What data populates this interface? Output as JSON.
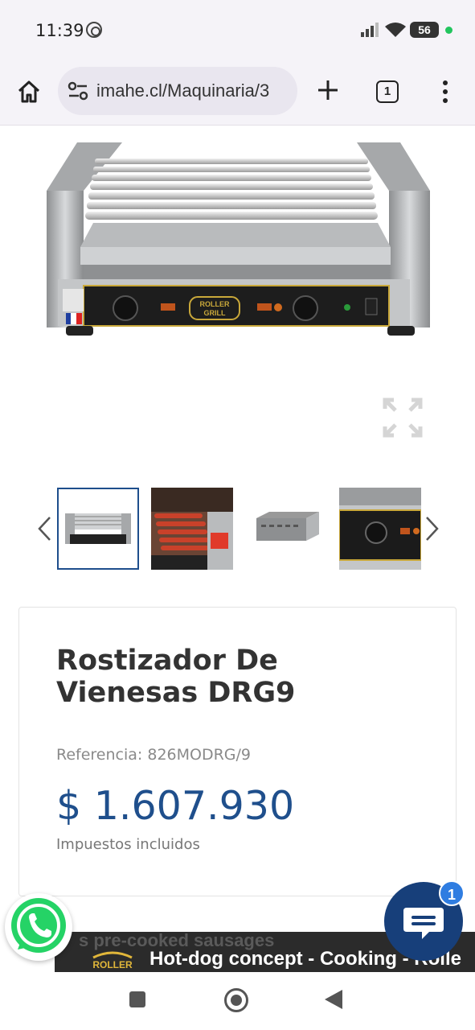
{
  "status_bar": {
    "time": "11:39",
    "battery": "56"
  },
  "browser": {
    "url": "imahe.cl/Maquinaria/3",
    "tab_count": "1"
  },
  "product": {
    "title": "Rostizador De Vienesas DRG9",
    "reference": "Referencia: 826MODRG/9",
    "price": "$ 1.607.930",
    "tax_note": "Impuestos incluidos"
  },
  "machine_label": {
    "brand_line1": "ROLLER",
    "brand_line2": "GRILL"
  },
  "video": {
    "subtitle": "s pre-cooked sausages",
    "logo_text": "ROLLER",
    "title": "Hot-dog concept - Cooking - Rolle"
  },
  "chat": {
    "badge_count": "1"
  },
  "colors": {
    "price": "#1f4f8c",
    "chat": "#173f7a",
    "whatsapp": "#25d366"
  }
}
